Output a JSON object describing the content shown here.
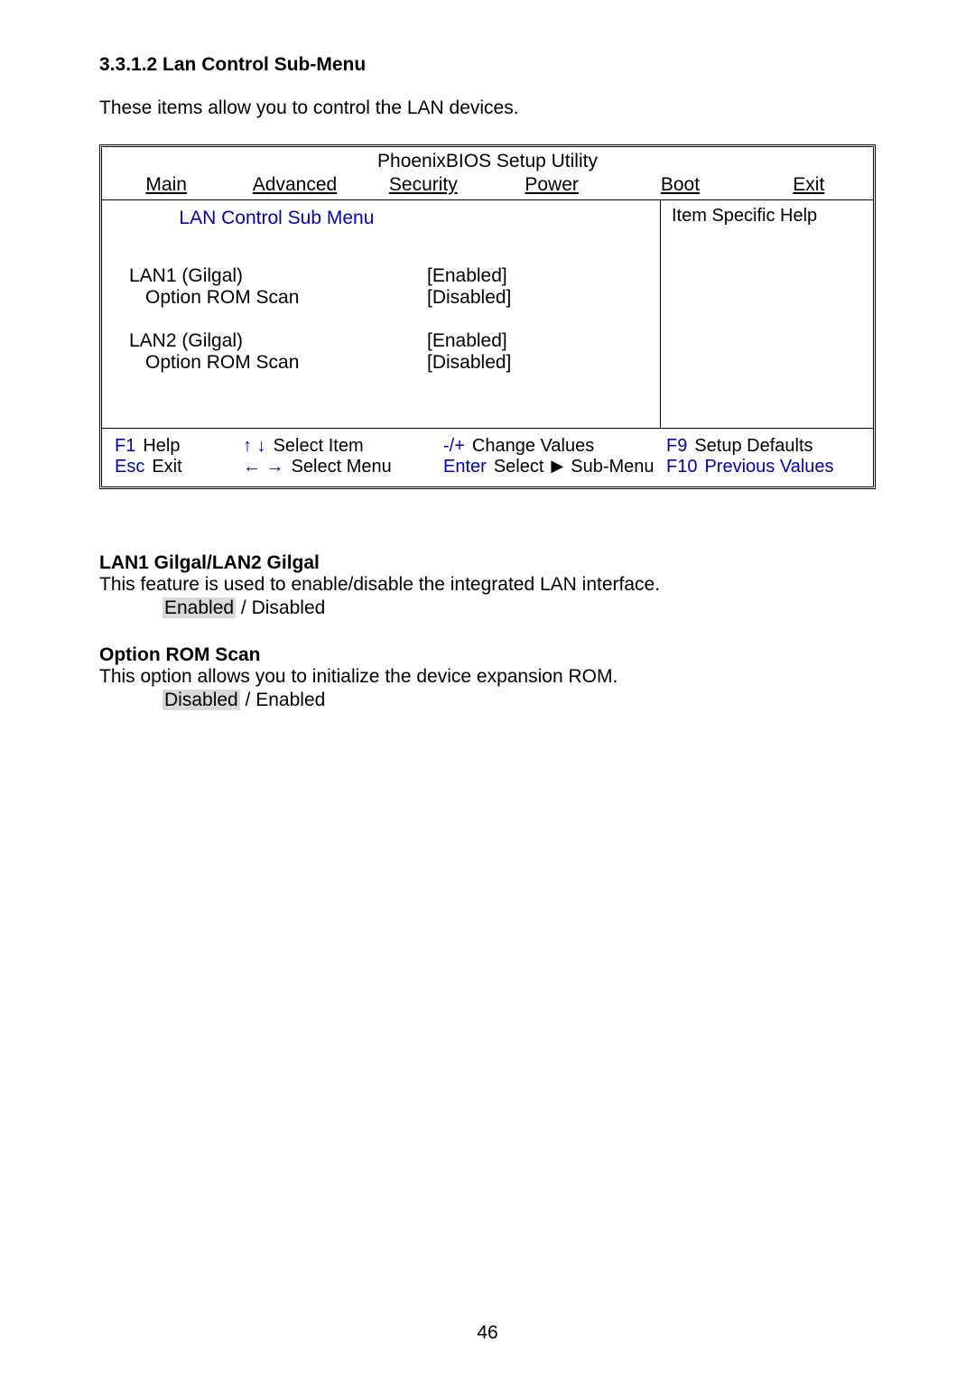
{
  "heading": "3.3.1.2 Lan Control Sub-Menu",
  "intro": "These items allow you to control the LAN devices.",
  "bios": {
    "title": "PhoenixBIOS Setup Utility",
    "tabs": [
      "Main",
      "Advanced",
      "Security",
      "Power",
      "Boot",
      "Exit"
    ],
    "submenu_title": "LAN Control Sub Menu",
    "help_title": "Item Specific Help",
    "settings": [
      {
        "label": "LAN1 (Gilgal)",
        "value": "[Enabled]",
        "indent": false
      },
      {
        "label": "Option ROM Scan",
        "value": "[Disabled]",
        "indent": true
      },
      {
        "label": "LAN2 (Gilgal)",
        "value": "[Enabled]",
        "indent": false
      },
      {
        "label": "Option ROM Scan",
        "value": "[Disabled]",
        "indent": true
      }
    ],
    "footer": {
      "r1": {
        "k1": "F1",
        "l1": "Help",
        "k2": "↑ ↓",
        "l2": "Select Item",
        "k3": "-/+",
        "l3": "Change Values",
        "k4": "F9",
        "l4": "Setup Defaults"
      },
      "r2": {
        "k1": "Esc",
        "l1": "Exit",
        "k2": "← →",
        "l2": "Select Menu",
        "k3": "Enter",
        "l3a": "Select",
        "l3b": "Sub-Menu",
        "k4": "F10",
        "l4": "Previous Values"
      }
    }
  },
  "desc1": {
    "heading": "LAN1 Gilgal/LAN2 Gilgal",
    "text": "This feature is used to enable/disable the integrated LAN interface.",
    "opt_hl": "Enabled",
    "opt_sep": " / ",
    "opt_other": "Disabled"
  },
  "desc2": {
    "heading": "Option ROM Scan",
    "text": "This option allows you to initialize the device expansion ROM.",
    "opt_hl": "Disabled",
    "opt_sep": " / ",
    "opt_other": "Enabled"
  },
  "page_number": "46"
}
